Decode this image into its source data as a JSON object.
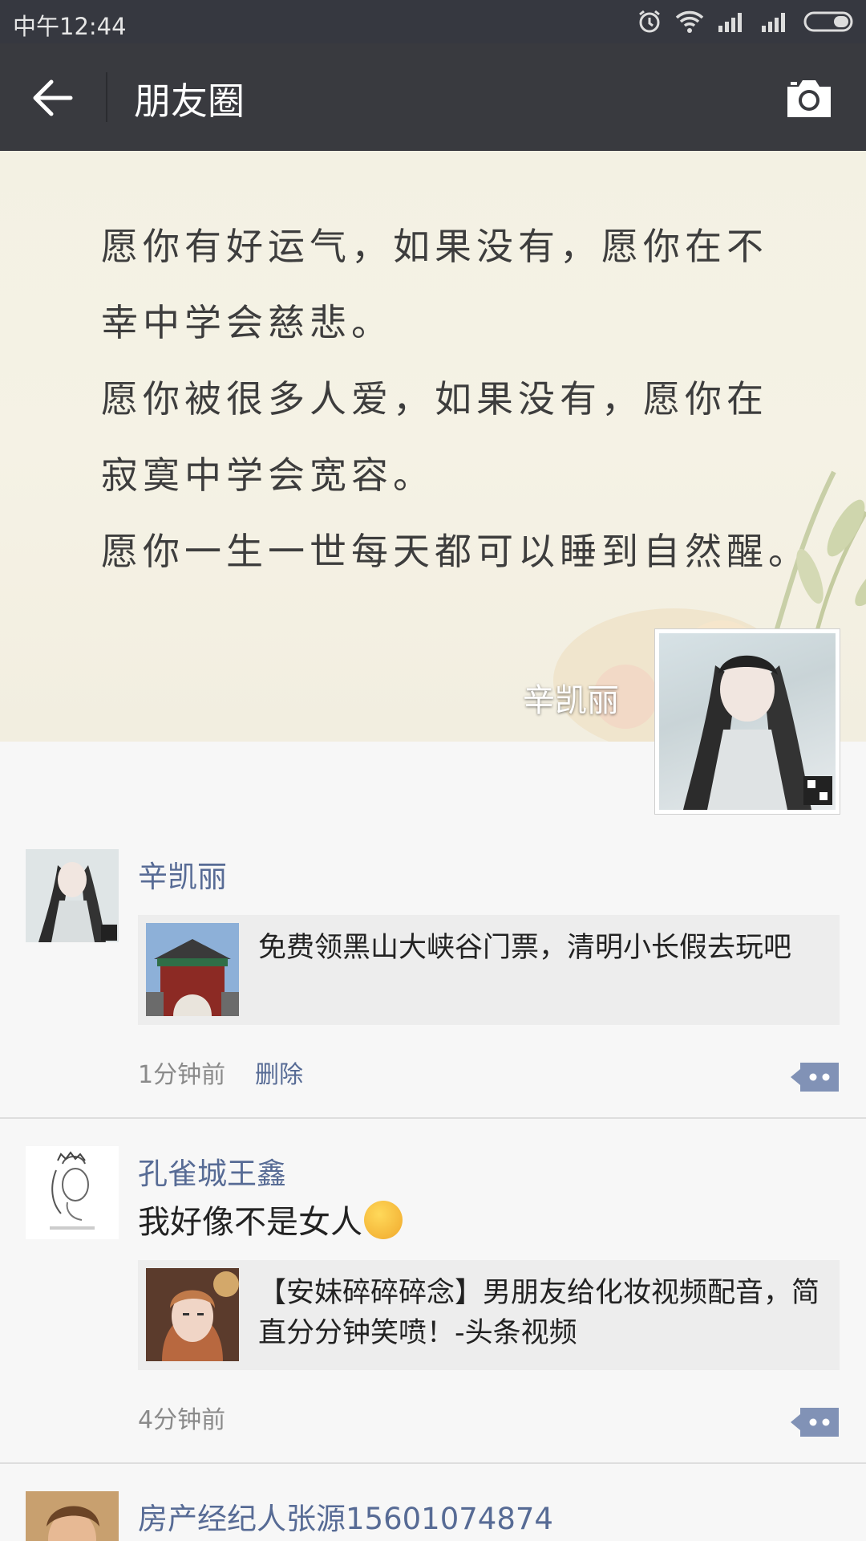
{
  "status_bar": {
    "time": "中午12:44"
  },
  "header": {
    "title": "朋友圈"
  },
  "cover": {
    "quote_lines": [
      "愿你有好运气，如果没有，愿你在不",
      "幸中学会慈悲。",
      "愿你被很多人爱，如果没有，愿你在",
      "寂寞中学会宽容。",
      "愿你一生一世每天都可以睡到自然醒。"
    ],
    "owner_name": "辛凯丽"
  },
  "posts": [
    {
      "author": "辛凯丽",
      "share_title": "免费领黑山大峡谷门票，清明小长假去玩吧",
      "time": "1分钟前",
      "delete_label": "删除"
    },
    {
      "author": "孔雀城王鑫",
      "text": "我好像不是女人",
      "share_title": "【安妹碎碎碎念】男朋友给化妆视频配音，简直分分钟笑喷！-头条视频",
      "time": "4分钟前"
    },
    {
      "author": "房产经纪人张源15601074874"
    }
  ],
  "colors": {
    "nav_bg": "#393a3f",
    "link_blue": "#576b95",
    "share_bg": "#ededed"
  }
}
